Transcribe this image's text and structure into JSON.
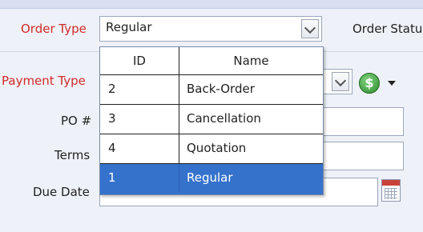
{
  "form": {
    "order_type_label": "Order Type",
    "order_type_value": "Regular",
    "order_status_label": "Order Statu",
    "payment_type_label": "Payment Type",
    "po_label": "PO #",
    "terms_label": "Terms",
    "due_date_label": "Due Date"
  },
  "dropdown": {
    "headers": [
      "ID",
      "Name"
    ],
    "rows": [
      {
        "id": "2",
        "name": "Back-Order"
      },
      {
        "id": "3",
        "name": "Cancellation"
      },
      {
        "id": "4",
        "name": "Quotation"
      },
      {
        "id": "1",
        "name": "Regular"
      }
    ],
    "selected_index": 3
  },
  "icons": {
    "money": "dollar-icon",
    "money_glyph": "$",
    "calendar": "calendar-icon"
  },
  "colors": {
    "required_label": "#d12b2b",
    "selection": "#3572cc"
  }
}
